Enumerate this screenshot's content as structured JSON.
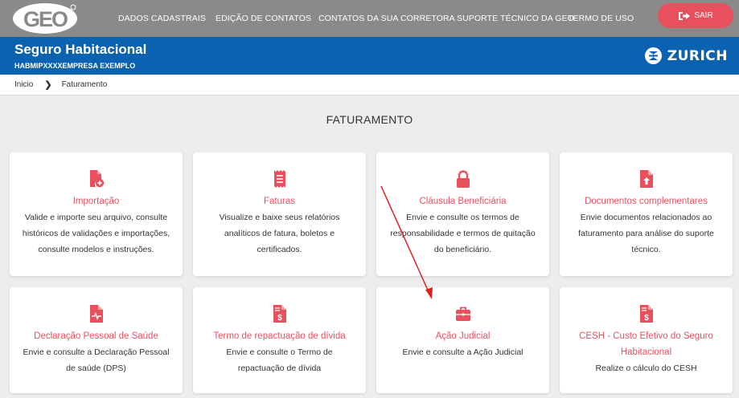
{
  "topbar": {
    "logo_text": "GEO",
    "nav": [
      "DADOS CADASTRAIS",
      "EDIÇÃO DE CONTATOS",
      "CONTATOS DA SUA CORRETORA",
      "SUPORTE TÉCNICO DA GEO",
      "TERMO DE USO"
    ],
    "logout_label": "SAIR"
  },
  "header": {
    "title": "Seguro Habitacional",
    "code": "HABMIPXXXX",
    "company": "EMPRESA EXEMPLO",
    "insurer": "ZURICH"
  },
  "breadcrumb": {
    "home": "Inicio",
    "current": "Faturamento"
  },
  "section_title": "FATURAMENTO",
  "cards": [
    {
      "title": "Importação",
      "desc": [
        "Valide e importe seu arquivo, consulte",
        "históricos de validações e importações,",
        "consulte modelos e instruções."
      ],
      "icon": "file-add-icon"
    },
    {
      "title": "Faturas",
      "desc": [
        "Visualize e baixe seus relatórios",
        "analíticos de fatura, boletos e",
        "certificados."
      ],
      "icon": "receipt-icon"
    },
    {
      "title": "Cláusula Beneficiária",
      "desc": [
        "Envie e consulte os termos de",
        "responsabilidade e termos de quitação",
        "do beneficiário."
      ],
      "icon": "lock-icon"
    },
    {
      "title": "Documentos complementares",
      "desc": [
        "Envie documentos relacionados ao",
        "faturamento para análise do suporte",
        "técnico."
      ],
      "icon": "file-upload-icon"
    },
    {
      "title": "Declaração Pessoal de Saúde",
      "desc": [
        "Envie e consulte a Declaração Pessoal",
        "de saúde (DPS)"
      ],
      "icon": "file-medical-icon"
    },
    {
      "title": "Termo de repactuação de dívida",
      "desc": [
        "Envie e consulte o Termo de",
        "repactuação de dívida"
      ],
      "icon": "file-dollar-icon"
    },
    {
      "title": "Ação Judicial",
      "desc": [
        "Envie e consulte a Ação Judicial"
      ],
      "icon": "briefcase-icon"
    },
    {
      "title": "CESH - Custo Efetivo do Seguro Habitacional",
      "title_lines": [
        "CESH - Custo Efetivo do Seguro",
        "Habitacional"
      ],
      "desc": [
        "Realize o cálculo do CESH"
      ],
      "icon": "file-dollar-icon"
    }
  ],
  "colors": {
    "topbar": "#8a8a8a",
    "brand_blue": "#0a62b0",
    "accent_red": "#e8505e",
    "annotation_arrow": "#e02020"
  }
}
